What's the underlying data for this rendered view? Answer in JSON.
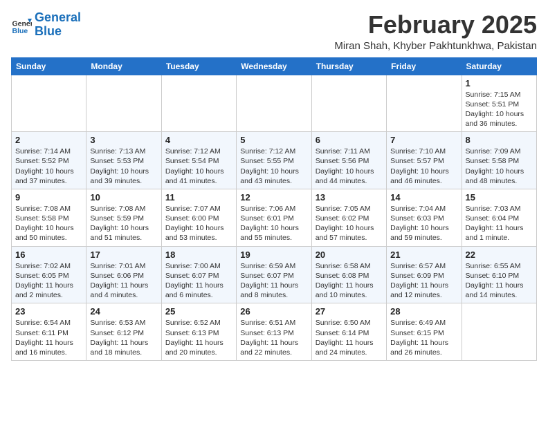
{
  "header": {
    "logo_line1": "General",
    "logo_line2": "Blue",
    "month": "February 2025",
    "location": "Miran Shah, Khyber Pakhtunkhwa, Pakistan"
  },
  "weekdays": [
    "Sunday",
    "Monday",
    "Tuesday",
    "Wednesday",
    "Thursday",
    "Friday",
    "Saturday"
  ],
  "weeks": [
    [
      {
        "day": "",
        "info": ""
      },
      {
        "day": "",
        "info": ""
      },
      {
        "day": "",
        "info": ""
      },
      {
        "day": "",
        "info": ""
      },
      {
        "day": "",
        "info": ""
      },
      {
        "day": "",
        "info": ""
      },
      {
        "day": "1",
        "info": "Sunrise: 7:15 AM\nSunset: 5:51 PM\nDaylight: 10 hours\nand 36 minutes."
      }
    ],
    [
      {
        "day": "2",
        "info": "Sunrise: 7:14 AM\nSunset: 5:52 PM\nDaylight: 10 hours\nand 37 minutes."
      },
      {
        "day": "3",
        "info": "Sunrise: 7:13 AM\nSunset: 5:53 PM\nDaylight: 10 hours\nand 39 minutes."
      },
      {
        "day": "4",
        "info": "Sunrise: 7:12 AM\nSunset: 5:54 PM\nDaylight: 10 hours\nand 41 minutes."
      },
      {
        "day": "5",
        "info": "Sunrise: 7:12 AM\nSunset: 5:55 PM\nDaylight: 10 hours\nand 43 minutes."
      },
      {
        "day": "6",
        "info": "Sunrise: 7:11 AM\nSunset: 5:56 PM\nDaylight: 10 hours\nand 44 minutes."
      },
      {
        "day": "7",
        "info": "Sunrise: 7:10 AM\nSunset: 5:57 PM\nDaylight: 10 hours\nand 46 minutes."
      },
      {
        "day": "8",
        "info": "Sunrise: 7:09 AM\nSunset: 5:58 PM\nDaylight: 10 hours\nand 48 minutes."
      }
    ],
    [
      {
        "day": "9",
        "info": "Sunrise: 7:08 AM\nSunset: 5:58 PM\nDaylight: 10 hours\nand 50 minutes."
      },
      {
        "day": "10",
        "info": "Sunrise: 7:08 AM\nSunset: 5:59 PM\nDaylight: 10 hours\nand 51 minutes."
      },
      {
        "day": "11",
        "info": "Sunrise: 7:07 AM\nSunset: 6:00 PM\nDaylight: 10 hours\nand 53 minutes."
      },
      {
        "day": "12",
        "info": "Sunrise: 7:06 AM\nSunset: 6:01 PM\nDaylight: 10 hours\nand 55 minutes."
      },
      {
        "day": "13",
        "info": "Sunrise: 7:05 AM\nSunset: 6:02 PM\nDaylight: 10 hours\nand 57 minutes."
      },
      {
        "day": "14",
        "info": "Sunrise: 7:04 AM\nSunset: 6:03 PM\nDaylight: 10 hours\nand 59 minutes."
      },
      {
        "day": "15",
        "info": "Sunrise: 7:03 AM\nSunset: 6:04 PM\nDaylight: 11 hours\nand 1 minute."
      }
    ],
    [
      {
        "day": "16",
        "info": "Sunrise: 7:02 AM\nSunset: 6:05 PM\nDaylight: 11 hours\nand 2 minutes."
      },
      {
        "day": "17",
        "info": "Sunrise: 7:01 AM\nSunset: 6:06 PM\nDaylight: 11 hours\nand 4 minutes."
      },
      {
        "day": "18",
        "info": "Sunrise: 7:00 AM\nSunset: 6:07 PM\nDaylight: 11 hours\nand 6 minutes."
      },
      {
        "day": "19",
        "info": "Sunrise: 6:59 AM\nSunset: 6:07 PM\nDaylight: 11 hours\nand 8 minutes."
      },
      {
        "day": "20",
        "info": "Sunrise: 6:58 AM\nSunset: 6:08 PM\nDaylight: 11 hours\nand 10 minutes."
      },
      {
        "day": "21",
        "info": "Sunrise: 6:57 AM\nSunset: 6:09 PM\nDaylight: 11 hours\nand 12 minutes."
      },
      {
        "day": "22",
        "info": "Sunrise: 6:55 AM\nSunset: 6:10 PM\nDaylight: 11 hours\nand 14 minutes."
      }
    ],
    [
      {
        "day": "23",
        "info": "Sunrise: 6:54 AM\nSunset: 6:11 PM\nDaylight: 11 hours\nand 16 minutes."
      },
      {
        "day": "24",
        "info": "Sunrise: 6:53 AM\nSunset: 6:12 PM\nDaylight: 11 hours\nand 18 minutes."
      },
      {
        "day": "25",
        "info": "Sunrise: 6:52 AM\nSunset: 6:13 PM\nDaylight: 11 hours\nand 20 minutes."
      },
      {
        "day": "26",
        "info": "Sunrise: 6:51 AM\nSunset: 6:13 PM\nDaylight: 11 hours\nand 22 minutes."
      },
      {
        "day": "27",
        "info": "Sunrise: 6:50 AM\nSunset: 6:14 PM\nDaylight: 11 hours\nand 24 minutes."
      },
      {
        "day": "28",
        "info": "Sunrise: 6:49 AM\nSunset: 6:15 PM\nDaylight: 11 hours\nand 26 minutes."
      },
      {
        "day": "",
        "info": ""
      }
    ]
  ]
}
